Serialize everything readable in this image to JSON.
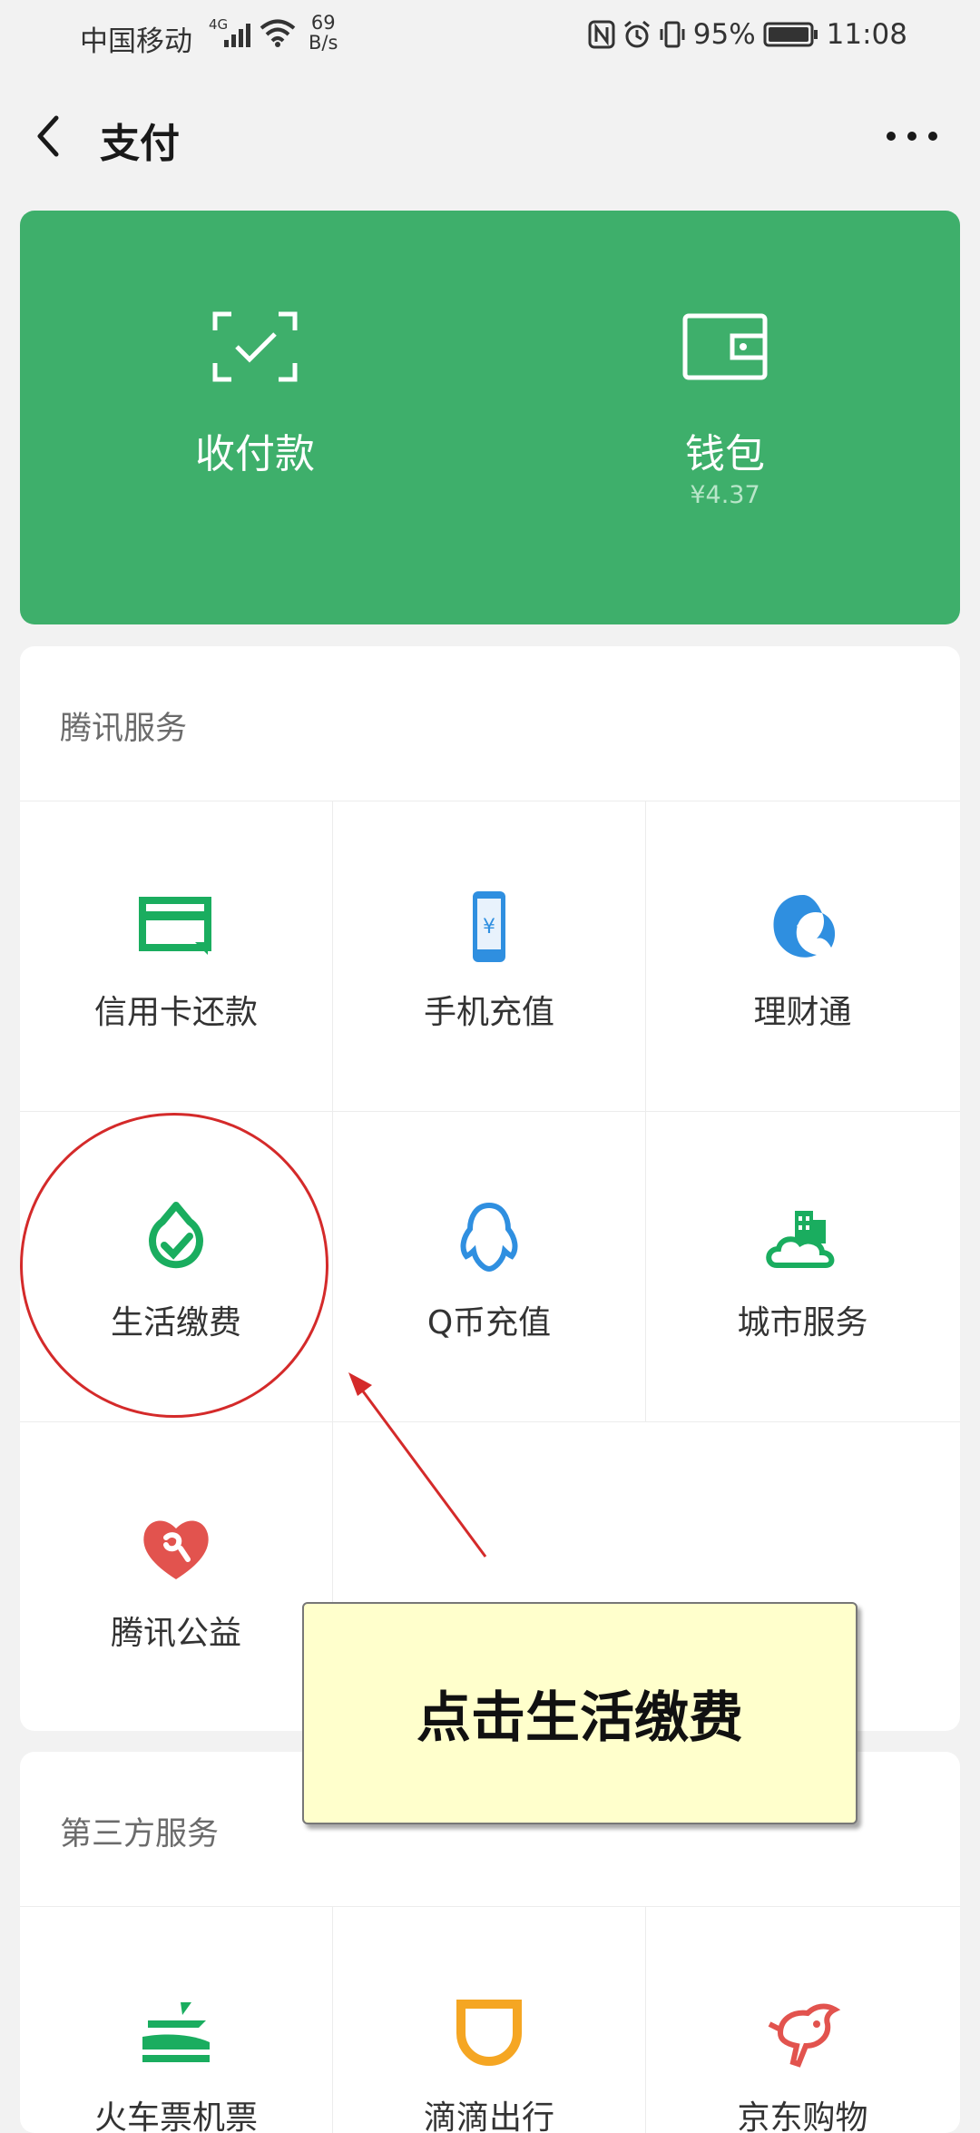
{
  "status_bar": {
    "carrier": "中国移动",
    "network": "4G",
    "speed_value": "69",
    "speed_unit": "B/s",
    "battery": "95%",
    "time": "11:08"
  },
  "header": {
    "title": "支付"
  },
  "wallet_card": {
    "color": "#3eaf6b",
    "pay_label": "收付款",
    "wallet_label": "钱包",
    "wallet_balance": "¥4.37"
  },
  "tencent_services": {
    "title": "腾讯服务",
    "items": [
      {
        "label": "信用卡还款",
        "icon": "credit-card-icon"
      },
      {
        "label": "手机充值",
        "icon": "phone-topup-icon"
      },
      {
        "label": "理财通",
        "icon": "wealth-icon"
      },
      {
        "label": "生活缴费",
        "icon": "utility-bill-icon"
      },
      {
        "label": "Q币充值",
        "icon": "qq-penguin-icon"
      },
      {
        "label": "城市服务",
        "icon": "city-service-icon"
      },
      {
        "label": "腾讯公益",
        "icon": "charity-heart-icon"
      }
    ]
  },
  "third_party_services": {
    "title": "第三方服务",
    "items": [
      {
        "label": "火车票机票",
        "icon": "train-plane-icon"
      },
      {
        "label": "滴滴出行",
        "icon": "didi-icon"
      },
      {
        "label": "京东购物",
        "icon": "jd-dog-icon"
      }
    ]
  },
  "annotation": {
    "callout_text": "点击生活缴费",
    "highlight_color": "#d42a2a"
  }
}
